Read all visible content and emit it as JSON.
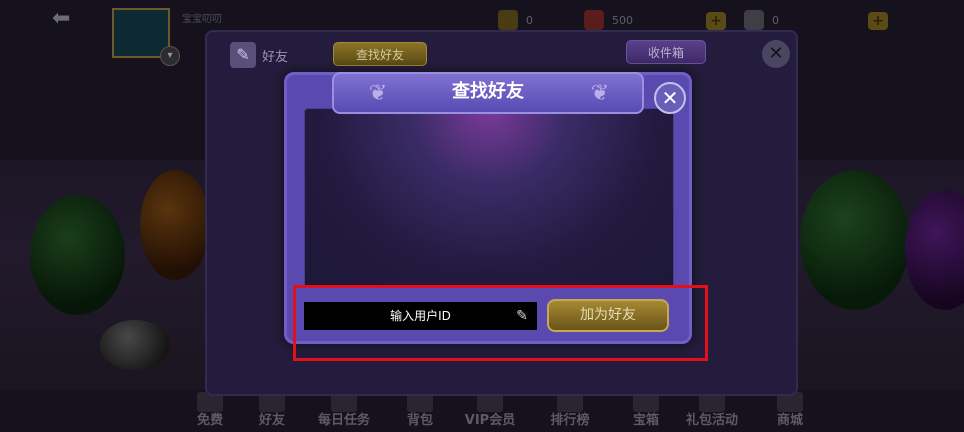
{
  "player": {
    "name": "宝宝叨叨"
  },
  "stats": {
    "trophies": "0",
    "chips": "500",
    "coupons": "0"
  },
  "friends_panel": {
    "title": "好友",
    "tab_search": "查找好友",
    "inbox": "收件箱",
    "close": "✕"
  },
  "dialog": {
    "title": "查找好友",
    "close": "✕",
    "input_placeholder": "输入用户ID",
    "add_button": "加为好友"
  },
  "bottom_nav": [
    "免费",
    "好友",
    "每日任务",
    "背包",
    "VIP会员",
    "排行榜",
    "宝箱",
    "礼包活动",
    "商城"
  ],
  "colors": {
    "accent_gold": "#a58a34",
    "dialog_purple": "#5a4ab0",
    "highlight_red": "#e3101b"
  }
}
